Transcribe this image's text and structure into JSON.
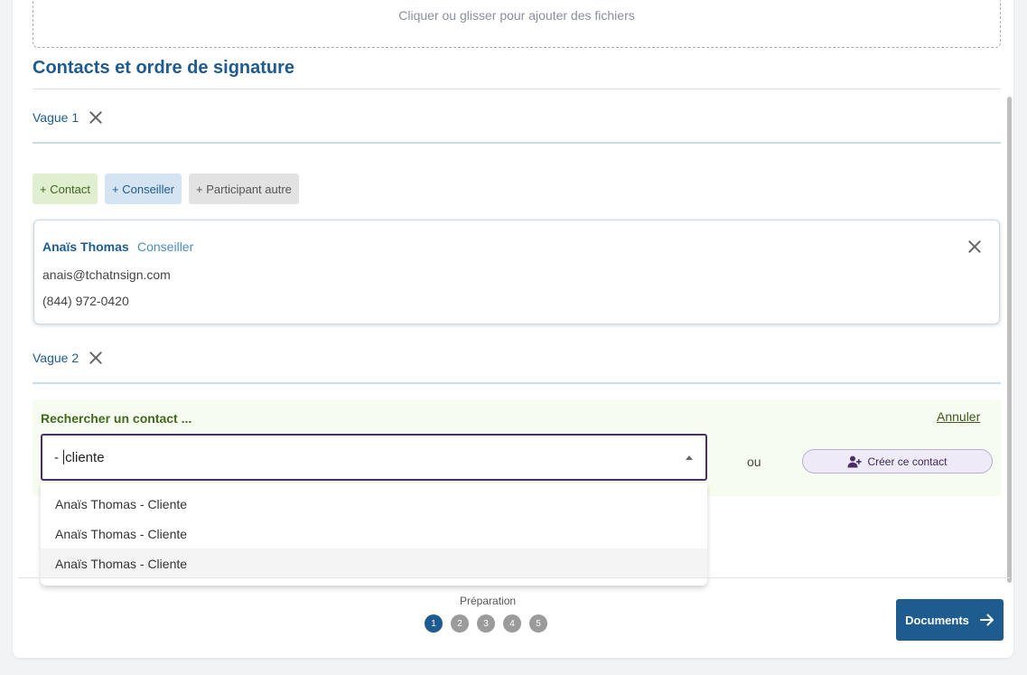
{
  "upload": {
    "hint": "Cliquer ou glisser pour ajouter des fichiers"
  },
  "section": {
    "title": "Contacts et ordre de signature"
  },
  "waves": [
    {
      "label": "Vague 1"
    },
    {
      "label": "Vague 2"
    }
  ],
  "add_buttons": {
    "contact": "+ Contact",
    "conseiller": "+ Conseiller",
    "autre": "+ Participant autre"
  },
  "person": {
    "name": "Anaïs Thomas",
    "role": "Conseiller",
    "email": "anais@tchatnsign.com",
    "phone": "(844) 972-0420"
  },
  "search": {
    "title": "Rechercher un contact ...",
    "cancel": "Annuler",
    "value_before_caret": "- ",
    "value_after_caret": "cliente",
    "or": "ou",
    "create": "Créer ce contact"
  },
  "suggestions": [
    "Anaïs Thomas - Cliente",
    "Anaïs Thomas - Cliente",
    "Anaïs Thomas - Cliente"
  ],
  "stepper": {
    "label": "Préparation",
    "steps": [
      "1",
      "2",
      "3",
      "4",
      "5"
    ],
    "active": 1
  },
  "next_button": {
    "label": "Documents"
  },
  "colors": {
    "primary": "#1e5b8e",
    "contact_bg": "#dfefcf",
    "conseiller_bg": "#d5e4f3",
    "search_border": "#4a2e6c"
  }
}
